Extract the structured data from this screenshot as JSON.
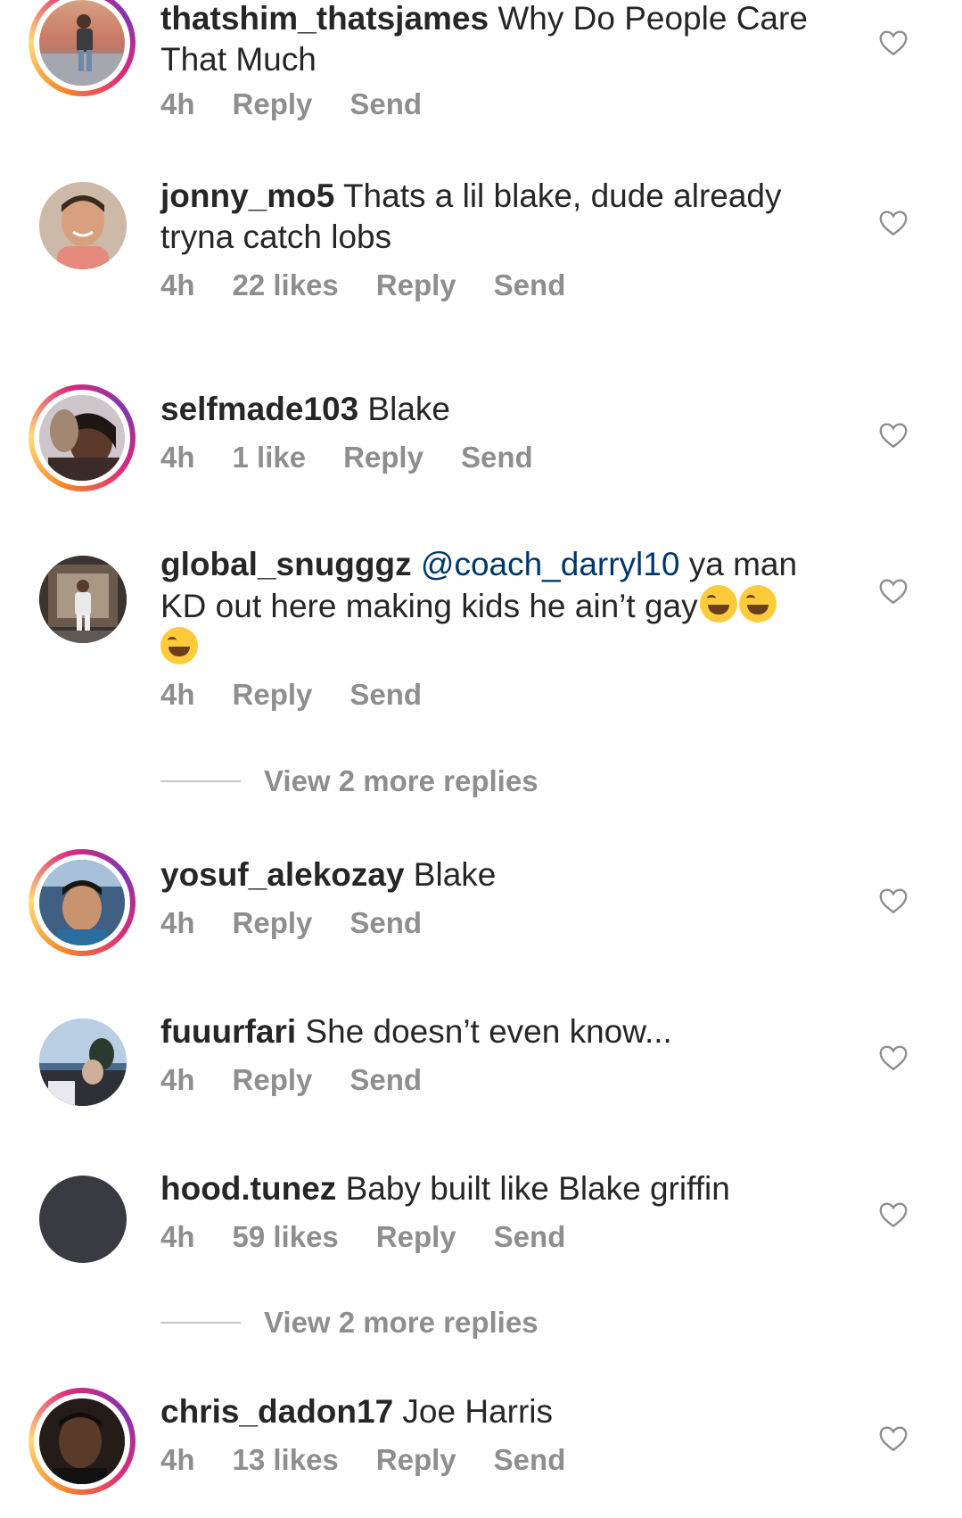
{
  "comments": [
    {
      "username": "thatshim_thatsjames",
      "text_line1": " Why Do People Care",
      "text_line2": "That Much",
      "time": "4h",
      "reply": "Reply",
      "send": "Send",
      "story_ring": true
    },
    {
      "username": "jonny_mo5",
      "text_line1": " Thats a lil blake, dude already",
      "text_line2": "tryna catch lobs",
      "time": "4h",
      "likes": "22 likes",
      "reply": "Reply",
      "send": "Send",
      "story_ring": false
    },
    {
      "username": "selfmade103",
      "text_line1": " Blake",
      "time": "4h",
      "likes": "1 like",
      "reply": "Reply",
      "send": "Send",
      "story_ring": true
    },
    {
      "username": "global_snugggz",
      "mention": "@coach_darryl10",
      "text_line1": " ya man",
      "text_line2": "KD out here making kids he ain’t gay",
      "emoji_name": "face-with-tears-of-joy",
      "time": "4h",
      "reply": "Reply",
      "send": "Send",
      "story_ring": false,
      "view_more": "View 2 more replies"
    },
    {
      "username": "yosuf_alekozay",
      "text_line1": " Blake",
      "time": "4h",
      "reply": "Reply",
      "send": "Send",
      "story_ring": true
    },
    {
      "username": "fuuurfari",
      "text_line1": " She doesn’t even know...",
      "time": "4h",
      "reply": "Reply",
      "send": "Send",
      "story_ring": false
    },
    {
      "username": "hood.tunez",
      "text_line1": " Baby built like Blake griffin",
      "time": "4h",
      "likes": "59 likes",
      "reply": "Reply",
      "send": "Send",
      "story_ring": false,
      "view_more": "View 2 more replies"
    },
    {
      "username": "chris_dadon17",
      "text_line1": " Joe Harris",
      "time": "4h",
      "likes": "13 likes",
      "reply": "Reply",
      "send": "Send",
      "story_ring": true
    }
  ],
  "colors": {
    "text": "#262626",
    "meta": "#8e8e8e",
    "mention": "#00376b",
    "ring_start": "#f58529",
    "ring_end": "#dd2a7b"
  },
  "icons": {
    "like": "heart-outline-icon"
  }
}
